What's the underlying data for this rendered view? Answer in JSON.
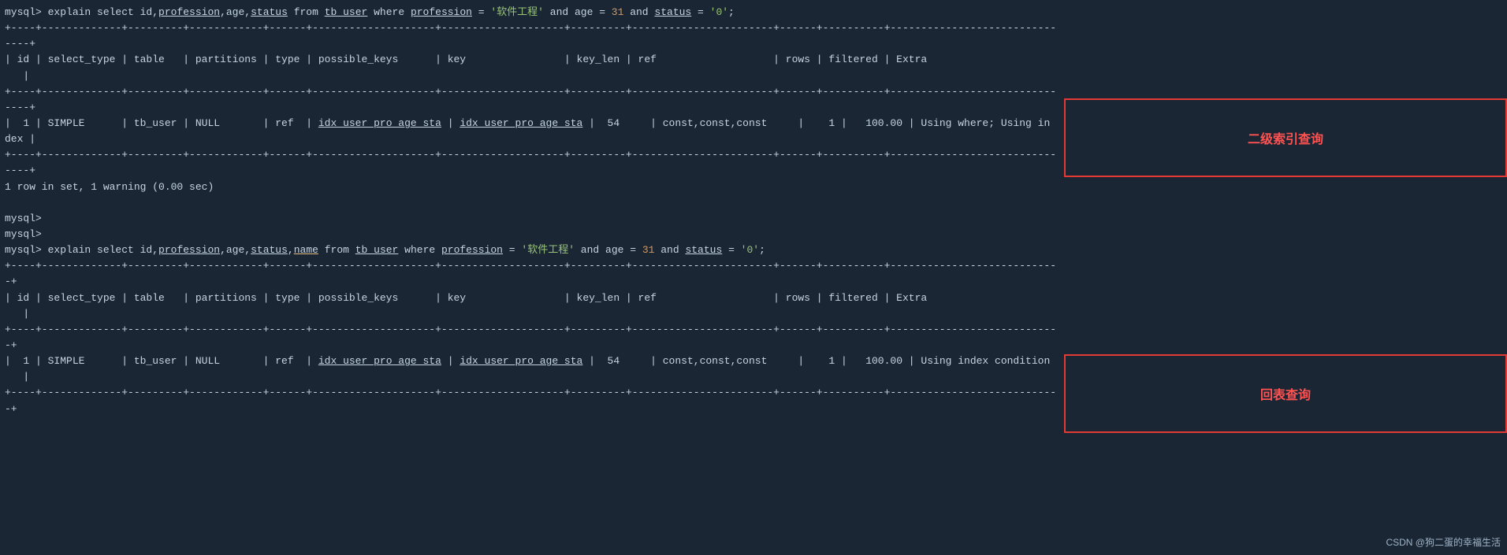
{
  "terminal": {
    "background": "#1a2633",
    "text_color": "#c5d4e3"
  },
  "lines": [
    {
      "id": "l1",
      "text": "mysql> explain select id,profession,age,status from tb_user where profession = '软件工程' and age = 31 and status = '0';",
      "type": "prompt"
    },
    {
      "id": "l2",
      "text": "+----+-------------+---------+------------+------+--------------------+--------------------+---------+-----------------------+------+----------+------------------------------+",
      "type": "border"
    },
    {
      "id": "l3",
      "text": "----+",
      "type": "border"
    },
    {
      "id": "l4",
      "text": "| id | select_type | table   | partitions | type | possible_keys      | key                | key_len | ref                   | rows | filtered | Extra                        |",
      "type": "header"
    },
    {
      "id": "l5",
      "text": "   |",
      "type": "header"
    },
    {
      "id": "l6",
      "text": "+----+-------------+---------+------------+------+--------------------+--------------------+---------+-----------------------+------+----------+------------------------------+",
      "type": "border"
    },
    {
      "id": "l7",
      "text": "----+",
      "type": "border"
    },
    {
      "id": "l8",
      "text": "|  1 | SIMPLE      | tb_user | NULL       | ref  | idx_user_pro_age_sta | idx_user_pro_age_sta |  54     | const,const,const     |    1 |   100.00 | Using where; Using in",
      "type": "data"
    },
    {
      "id": "l9",
      "text": "dex |",
      "type": "data"
    },
    {
      "id": "l10",
      "text": "+----+-------------+---------+------------+------+--------------------+--------------------+---------+-----------------------+------+----------+------------------------------+",
      "type": "border"
    },
    {
      "id": "l11",
      "text": "----+",
      "type": "border"
    },
    {
      "id": "l12",
      "text": "1 row in set, 1 warning (0.00 sec)",
      "type": "info"
    },
    {
      "id": "l13",
      "text": "",
      "type": "blank"
    },
    {
      "id": "l14",
      "text": "mysql>",
      "type": "prompt"
    },
    {
      "id": "l15",
      "text": "mysql>",
      "type": "prompt"
    },
    {
      "id": "l16",
      "text": "mysql> explain select id,profession,age,status,name from tb_user where profession = '软件工程' and age = 31 and status = '0';",
      "type": "prompt"
    },
    {
      "id": "l17",
      "text": "+----+-------------+---------+------------+------+--------------------+--------------------+---------+-----------------------+------+----------+------------------------------+",
      "type": "border"
    },
    {
      "id": "l18",
      "text": "-+",
      "type": "border"
    },
    {
      "id": "l19",
      "text": "| id | select_type | table   | partitions | type | possible_keys      | key                | key_len | ref                   | rows | filtered | Extra                        |",
      "type": "header"
    },
    {
      "id": "l20",
      "text": "   |",
      "type": "header"
    },
    {
      "id": "l21",
      "text": "+----+-------------+---------+------------+------+--------------------+--------------------+---------+-----------------------+------+----------+------------------------------+",
      "type": "border"
    },
    {
      "id": "l22",
      "text": "-+",
      "type": "border"
    },
    {
      "id": "l23",
      "text": "|  1 | SIMPLE      | tb_user | NULL       | ref  | idx_user_pro_age_sta | idx_user_pro_age_sta |  54     | const,const,const     |    1 |   100.00 | Using index condition",
      "type": "data"
    },
    {
      "id": "l24",
      "text": "   |",
      "type": "data"
    },
    {
      "id": "l25",
      "text": "+----+-------------+---------+------------+------+--------------------+--------------------+---------+-----------------------+------+----------+------------------------------+",
      "type": "border"
    },
    {
      "id": "l26",
      "text": "-+",
      "type": "border"
    }
  ],
  "annotations": {
    "first": {
      "label": "二级索引查询",
      "color": "#ff4444"
    },
    "second": {
      "label": "回表查询",
      "color": "#ff4444"
    }
  },
  "watermark": {
    "text": "CSDN @狗二蛋的幸福生活"
  }
}
